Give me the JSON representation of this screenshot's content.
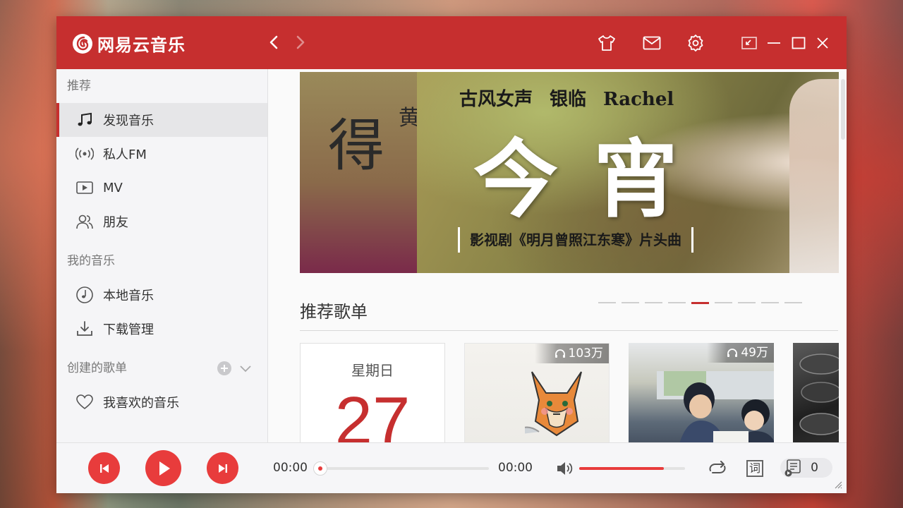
{
  "app": {
    "title": "网易云音乐",
    "accent_color": "#c62f2f",
    "play_color": "#e83c3c"
  },
  "titlebar": {
    "icons": [
      "arrow-left-icon",
      "arrow-right-icon",
      "shirt-icon",
      "mail-icon",
      "gear-icon",
      "mini-mode-icon",
      "minimize-icon",
      "maximize-icon",
      "close-icon"
    ]
  },
  "sidebar": {
    "section_recommend": "推荐",
    "items_recommend": [
      {
        "label": "发现音乐",
        "icon": "music-note-icon",
        "active": true
      },
      {
        "label": "私人FM",
        "icon": "radio-icon",
        "active": false
      },
      {
        "label": "MV",
        "icon": "video-icon",
        "active": false
      },
      {
        "label": "朋友",
        "icon": "friends-icon",
        "active": false
      }
    ],
    "section_my_music": "我的音乐",
    "items_my_music": [
      {
        "label": "本地音乐",
        "icon": "local-music-icon"
      },
      {
        "label": "下载管理",
        "icon": "download-icon"
      }
    ],
    "section_created": "创建的歌单",
    "items_created": [
      {
        "label": "我喜欢的音乐",
        "icon": "heart-icon"
      }
    ]
  },
  "banner": {
    "left_peek": {
      "big_char": "得",
      "small_char": "黄"
    },
    "headline": {
      "prefix": "古风女声",
      "artist": "银临",
      "artist_en": "Rachel"
    },
    "title": "今宵",
    "subtitle": "影视剧《明月曾照江东寒》片头曲",
    "dot_count": 9,
    "active_dot": 5
  },
  "recommend": {
    "title": "推荐歌单",
    "daily": {
      "weekday": "星期日",
      "day": "27"
    },
    "cards": [
      {
        "play_count": "103万"
      },
      {
        "play_count": "49万"
      }
    ]
  },
  "player": {
    "current_time": "00:00",
    "total_time": "00:00",
    "progress": 0,
    "volume": 0.8,
    "lyric_label": "词",
    "playlist_count": "0"
  }
}
